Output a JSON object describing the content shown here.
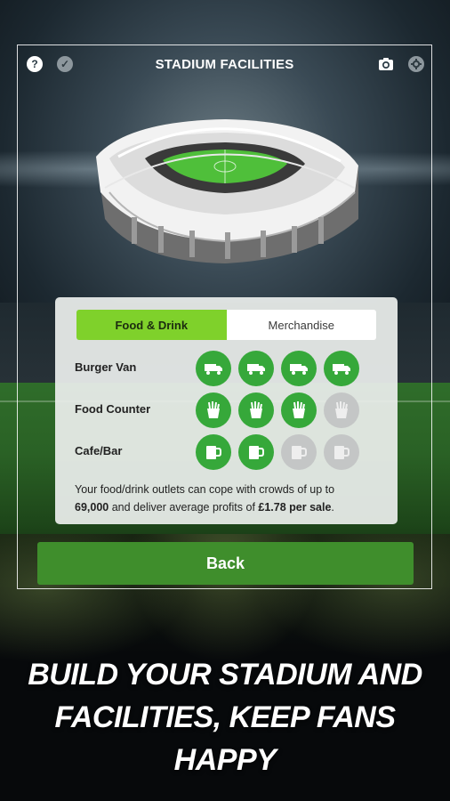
{
  "header": {
    "title": "STADIUM FACILITIES",
    "help_icon": "?",
    "check_icon": "✓",
    "left_icons": [
      "help-icon",
      "check-icon"
    ],
    "right_icons": [
      "camera-icon",
      "settings-icon"
    ]
  },
  "tabs": [
    {
      "label": "Food & Drink",
      "active": true
    },
    {
      "label": "Merchandise",
      "active": false
    }
  ],
  "facilities": [
    {
      "label": "Burger Van",
      "icon": "van-icon",
      "levels_owned": 4,
      "levels_total": 4
    },
    {
      "label": "Food Counter",
      "icon": "fries-icon",
      "levels_owned": 3,
      "levels_total": 4
    },
    {
      "label": "Cafe/Bar",
      "icon": "mug-icon",
      "levels_owned": 2,
      "levels_total": 4
    }
  ],
  "description": {
    "part1": "Your food/drink outlets can cope with crowds of up to",
    "capacity": "69,000",
    "part2": " and deliver average profits of ",
    "profit": "£1.78 per sale",
    "part3": "."
  },
  "back_label": "Back",
  "tagline": {
    "line1": "BUILD YOUR STADIUM AND",
    "line2": "FACILITIES, KEEP FANS HAPPY"
  },
  "colors": {
    "accent_green": "#7fd12b",
    "level_on": "#36a83a",
    "level_off": "#c4c6c6",
    "back_button": "#3f8e2c"
  }
}
